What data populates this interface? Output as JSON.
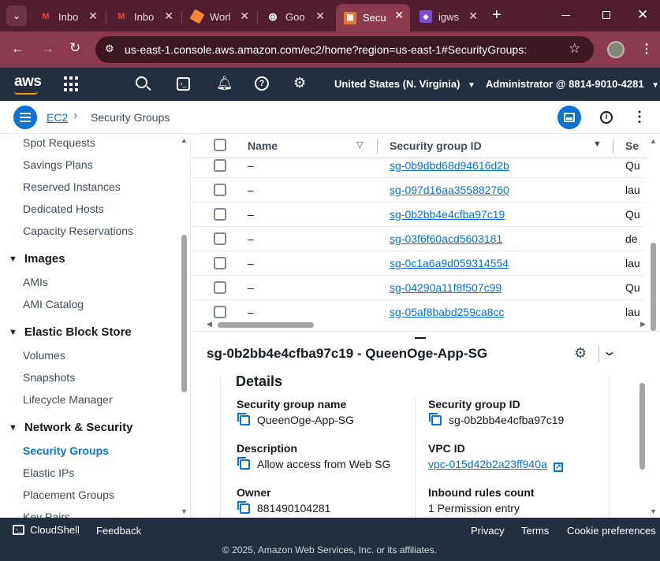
{
  "browser": {
    "tabs": [
      {
        "title": "Inbo",
        "icon": "gmail-icon"
      },
      {
        "title": "Inbo",
        "icon": "gmail-icon"
      },
      {
        "title": "Worl",
        "icon": "aws-orange-icon"
      },
      {
        "title": "Goo",
        "icon": "chatgpt-icon"
      },
      {
        "title": "Secu",
        "icon": "ec2-icon"
      },
      {
        "title": "igws",
        "icon": "vpc-icon"
      }
    ],
    "url": "us-east-1.console.aws.amazon.com/ec2/home?region=us-east-1#SecurityGroups:"
  },
  "aws_header": {
    "logo": "aws",
    "region": "United States (N. Virginia)",
    "account": "Administrator @ 8814-9010-4281"
  },
  "breadcrumb": {
    "service": "EC2",
    "page": "Security Groups"
  },
  "sidebar": {
    "items_top": [
      "Spot Requests",
      "Savings Plans",
      "Reserved Instances",
      "Dedicated Hosts",
      "Capacity Reservations"
    ],
    "sections": [
      {
        "title": "Images",
        "items": [
          "AMIs",
          "AMI Catalog"
        ]
      },
      {
        "title": "Elastic Block Store",
        "items": [
          "Volumes",
          "Snapshots",
          "Lifecycle Manager"
        ]
      },
      {
        "title": "Network & Security",
        "items": [
          "Security Groups",
          "Elastic IPs",
          "Placement Groups",
          "Key Pairs"
        ]
      }
    ],
    "active": "Security Groups"
  },
  "table": {
    "columns": [
      "Name",
      "Security group ID",
      "Se"
    ],
    "rows": [
      {
        "name": "–",
        "id": "sg-0b9dbd68d94616d2b",
        "extra": "Qu"
      },
      {
        "name": "–",
        "id": "sg-097d16aa355882760",
        "extra": "lau"
      },
      {
        "name": "–",
        "id": "sg-0b2bb4e4cfba97c19",
        "extra": "Qu"
      },
      {
        "name": "–",
        "id": "sg-03f6f60acd5603181",
        "extra": "de"
      },
      {
        "name": "–",
        "id": "sg-0c1a6a9d059314554",
        "extra": "lau"
      },
      {
        "name": "–",
        "id": "sg-04290a11f8f507c99",
        "extra": "Qu"
      },
      {
        "name": "–",
        "id": "sg-05af8babd259ca8cc",
        "extra": "lau"
      }
    ]
  },
  "detail": {
    "title": "sg-0b2bb4e4cfba97c19 - QueenOge-App-SG",
    "section": "Details",
    "fields": {
      "sg_name_label": "Security group name",
      "sg_name": "QueenOge-App-SG",
      "sg_id_label": "Security group ID",
      "sg_id": "sg-0b2bb4e4cfba97c19",
      "desc_label": "Description",
      "desc": "Allow access from Web SG",
      "vpc_label": "VPC ID",
      "vpc": "vpc-015d42b2a23ff940a",
      "owner_label": "Owner",
      "owner": "881490104281",
      "inbound_label": "Inbound rules count",
      "inbound": "1 Permission entry"
    }
  },
  "footer": {
    "cloudshell": "CloudShell",
    "feedback": "Feedback",
    "privacy": "Privacy",
    "terms": "Terms",
    "cookies": "Cookie preferences",
    "copyright": "© 2025, Amazon Web Services, Inc. or its affiliates."
  },
  "colors": {
    "tabbar": "#501e2f",
    "addressbar": "#8b3a4f",
    "aws_nav": "#232f3e",
    "link": "#0972d3"
  }
}
